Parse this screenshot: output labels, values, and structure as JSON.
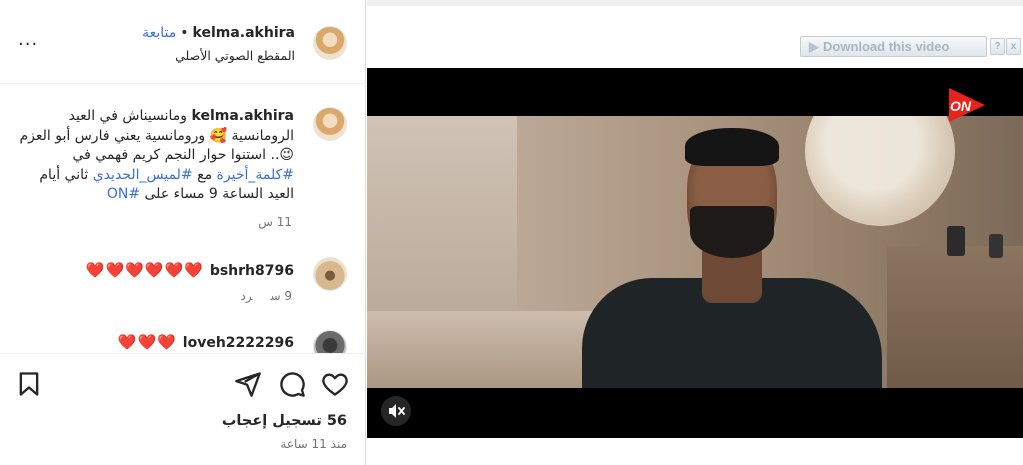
{
  "header": {
    "username": "kelma.akhira",
    "separator": "•",
    "follow_label": "متابعة",
    "audio_label": "المقطع الصوتي الأصلي",
    "more_label": "···"
  },
  "caption": {
    "username": "kelma.akhira",
    "text_part1": " ومانسيناش في العيد الرومانسية 🥰 ورومانسية يعني فارس أبو العزم😉.. استنوا حوار النجم كريم فهمي في ",
    "tag1": "#كلمة_أخيرة",
    "text_part2": " مع ",
    "tag2": "#لميس_الحديدي",
    "text_part3": " ثاني أيام العيد الساعة 9 مساء على ",
    "tag3": "#ON",
    "time": "11 س"
  },
  "comments": [
    {
      "username": "bshrh8796",
      "text": "❤️❤️❤️❤️❤️❤️",
      "time": "9 س",
      "reply_label": "رد"
    },
    {
      "username": "loveh2222296",
      "text": "❤️❤️❤️"
    }
  ],
  "footer": {
    "likes": "56 تسجيل إعجاب",
    "ago": "منذ 11 ساعة"
  },
  "downloader": {
    "label": "Download this video",
    "help": "?",
    "close": "x"
  },
  "video": {
    "channel_logo": "ON"
  },
  "icons": {
    "more": "more-dots-icon",
    "save": "bookmark-icon",
    "share": "send-icon",
    "comment": "comment-bubble-icon",
    "like": "heart-outline-icon",
    "mute": "volume-muted-icon",
    "play": "play-triangle-icon"
  },
  "colors": {
    "link": "#3a6fd8",
    "heart": "#e0162b",
    "on_brand": "#e8231b"
  }
}
